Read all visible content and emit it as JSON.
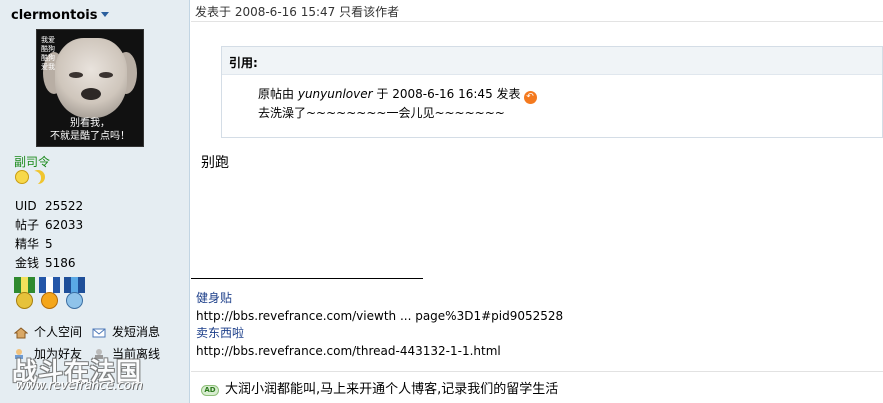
{
  "user": {
    "name": "clermontois",
    "avatar_caption": "别看我，\n不就是酷了点吗！",
    "avatar_corner_text": "我爱\n酷狗\n酷狗\n爱我",
    "rank": "副司令",
    "stats": [
      {
        "label": "UID",
        "value": "25522"
      },
      {
        "label": "帖子",
        "value": "62033"
      },
      {
        "label": "精华",
        "value": "5"
      },
      {
        "label": "金钱",
        "value": "5186"
      }
    ],
    "links": {
      "home": "个人空间",
      "message": "发短消息",
      "add_friend": "加为好友",
      "status": "当前离线"
    },
    "watermark_big": "战斗在法国",
    "watermark_small": "www.revefrance.com"
  },
  "post": {
    "posted_on": "发表于 2008-6-16 15:47",
    "only_author": "只看该作者",
    "quote": {
      "title": "引用:",
      "by_prefix": "原帖由",
      "author": "yunyunlover",
      "by_mid": "于 2008-6-16 16:45 发表",
      "text": "去洗澡了~~~~~~~~一会儿见~~~~~~~"
    },
    "message": "别跑",
    "signature": [
      {
        "title": "健身贴",
        "url": "http://bbs.revefrance.com/viewth ... page%3D1#pid9052528"
      },
      {
        "title": "卖东西啦",
        "url": "http://bbs.revefrance.com/thread-443132-1-1.html"
      }
    ],
    "ad": {
      "badge": "AD",
      "text": "大润小润都能叫,马上来开通个人博客,记录我们的留学生活"
    }
  }
}
